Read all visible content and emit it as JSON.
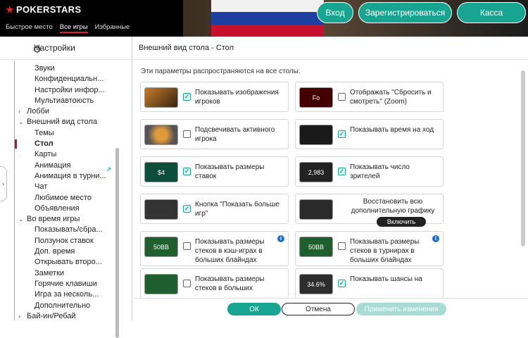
{
  "header": {
    "logo": "POKERSTARS",
    "nav": [
      "Быстрое место",
      "Все игры",
      "Избранные"
    ],
    "login_label": "Вход",
    "register_label": "Зарегистрироваться",
    "cashier_label": "Касса"
  },
  "sidebar": {
    "title": "Настройки",
    "items": [
      {
        "label": "Звуки",
        "level": 2
      },
      {
        "label": "Конфиденциальн...",
        "level": 2
      },
      {
        "label": "Настройки инфор...",
        "level": 2
      },
      {
        "label": "Мультиавтоюсть",
        "level": 2
      },
      {
        "label": "Лобби",
        "level": 1,
        "arrow": "›"
      },
      {
        "label": "Внешний вид стола",
        "level": 1,
        "arrow": "⌄"
      },
      {
        "label": "Темы",
        "level": 2
      },
      {
        "label": "Стол",
        "level": 2,
        "selected": true
      },
      {
        "label": "Карты",
        "level": 2
      },
      {
        "label": "Анимация",
        "level": 2
      },
      {
        "label": "Анимация в турни...",
        "level": 2
      },
      {
        "label": "Чат",
        "level": 2
      },
      {
        "label": "Любимое место",
        "level": 2
      },
      {
        "label": "Объявления",
        "level": 2
      },
      {
        "label": "Во время игры",
        "level": 1,
        "arrow": "⌄"
      },
      {
        "label": "Показывать/сбра...",
        "level": 2
      },
      {
        "label": "Ползунок ставок",
        "level": 2
      },
      {
        "label": "Доп. время",
        "level": 2
      },
      {
        "label": "Открывать второ...",
        "level": 2
      },
      {
        "label": "Заметки",
        "level": 2
      },
      {
        "label": "Горячие клавиши",
        "level": 2
      },
      {
        "label": "Игра за несколь...",
        "level": 2
      },
      {
        "label": "Дополнительно",
        "level": 2
      },
      {
        "label": "Бай-ин/Ребай",
        "level": 1,
        "arrow": "›"
      }
    ]
  },
  "main": {
    "title": "Внешний вид стола - Стол",
    "intro": "Эти параметры распространяются на все столы.",
    "cards": [
      {
        "text": "Показывать изображения игроков",
        "checked": true,
        "thumb": "tiger",
        "thumb_text": ""
      },
      {
        "text": "Отображать \"Сбросить и смотреть\" (Zoom)",
        "checked": false,
        "thumb": "zoom",
        "thumb_text": "Fo"
      },
      {
        "text": "Подсвечивать активного игрока",
        "checked": false,
        "thumb": "tiger2",
        "thumb_text": ""
      },
      {
        "text": "Показывать время на ход",
        "checked": true,
        "thumb": "bars",
        "thumb_text": ""
      },
      {
        "text": "Показывать размеры ставок",
        "checked": true,
        "thumb": "chips",
        "thumb_text": "$4"
      },
      {
        "text": "Показывать число зрителей",
        "checked": true,
        "thumb": "eye",
        "thumb_text": "2,983"
      },
      {
        "text": "Кнопка \"Показать больше игр\"",
        "checked": true,
        "thumb": "games",
        "thumb_text": ""
      },
      {
        "text": "Восстановить всю дополнительную графику стола",
        "checked": null,
        "thumb": "restore",
        "thumb_text": "",
        "button": "Включить"
      },
      {
        "text": "Показывать размеры стеков в кэш-играх в больших блайндах",
        "checked": false,
        "thumb": "stack",
        "thumb_text": "50BB",
        "info": true
      },
      {
        "text": "Показывать размеры стеков в турнирах в больших блайндах",
        "checked": false,
        "thumb": "stack",
        "thumb_text": "50BB",
        "info": true
      },
      {
        "text": "Показывать размеры стеков в больших",
        "checked": false,
        "thumb": "stack2",
        "thumb_text": ""
      },
      {
        "text": "Показывать шансы на",
        "checked": true,
        "thumb": "odds",
        "thumb_text": "34.6%"
      }
    ]
  },
  "footer": {
    "ok_label": "ОК",
    "cancel_label": "Отмена",
    "apply_label": "Применить изменения"
  },
  "colors": {
    "accent": "#17a591",
    "brand_red": "#e0202e",
    "selected_marker": "#c8102e"
  }
}
